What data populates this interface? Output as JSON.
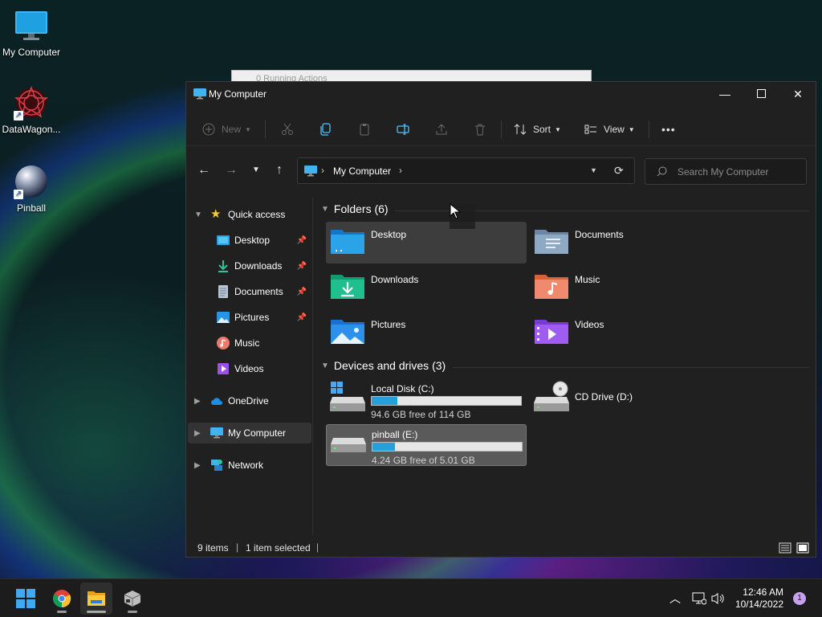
{
  "desktop": {
    "icons": [
      {
        "label": "My Computer"
      },
      {
        "label": "DataWagon..."
      },
      {
        "label": "Pinball"
      }
    ]
  },
  "background_dialog": {
    "title": "0 Running Actions"
  },
  "explorer": {
    "title": "My Computer",
    "toolbar": {
      "new_label": "New",
      "sort_label": "Sort",
      "view_label": "View",
      "more_label": "•••"
    },
    "address": {
      "crumb": "My Computer"
    },
    "search": {
      "placeholder": "Search My Computer"
    },
    "sidebar": {
      "quick_access": "Quick access",
      "quick_items": [
        {
          "label": "Desktop",
          "pinned": true
        },
        {
          "label": "Downloads",
          "pinned": true
        },
        {
          "label": "Documents",
          "pinned": true
        },
        {
          "label": "Pictures",
          "pinned": true
        },
        {
          "label": "Music",
          "pinned": false
        },
        {
          "label": "Videos",
          "pinned": false
        }
      ],
      "onedrive": "OneDrive",
      "my_computer": "My Computer",
      "network": "Network"
    },
    "folders_header": "Folders (6)",
    "folders": [
      {
        "name": "Desktop",
        "selected": true
      },
      {
        "name": "Documents",
        "selected": false
      },
      {
        "name": "Downloads",
        "selected": false
      },
      {
        "name": "Music",
        "selected": false
      },
      {
        "name": "Pictures",
        "selected": false
      },
      {
        "name": "Videos",
        "selected": false
      }
    ],
    "drives_header": "Devices and drives (3)",
    "drives": [
      {
        "name": "Local Disk (C:)",
        "free_text": "94.6 GB free of 114 GB",
        "used_fraction": 0.17,
        "selected": false
      },
      {
        "name": "CD Drive (D:)",
        "free_text": "",
        "used_fraction": null,
        "selected": false
      },
      {
        "name": "pinball (E:)",
        "free_text": "4.24 GB free of 5.01 GB",
        "used_fraction": 0.15,
        "selected": true
      }
    ],
    "status": {
      "items": "9 items",
      "selected": "1 item selected"
    }
  },
  "taskbar": {
    "time": "12:46 AM",
    "date": "10/14/2022",
    "notifications": "1"
  },
  "colors": {
    "accent": "#26a0da",
    "window_bg": "#202020",
    "taskbar_bg": "#1c1c1c"
  }
}
